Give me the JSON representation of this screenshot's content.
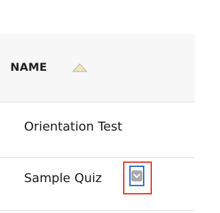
{
  "table": {
    "column_header": "NAME",
    "sort_icon": "sort-ascending-triangle-icon",
    "rows": [
      {
        "name": "Orientation Test"
      },
      {
        "name": "Sample Quiz",
        "action_icon": "chevron-down-icon"
      }
    ]
  },
  "colors": {
    "highlight_border": "#e8402e",
    "focus_border": "#2a6fd6",
    "sort_icon_fill": "#f3e7b4"
  }
}
